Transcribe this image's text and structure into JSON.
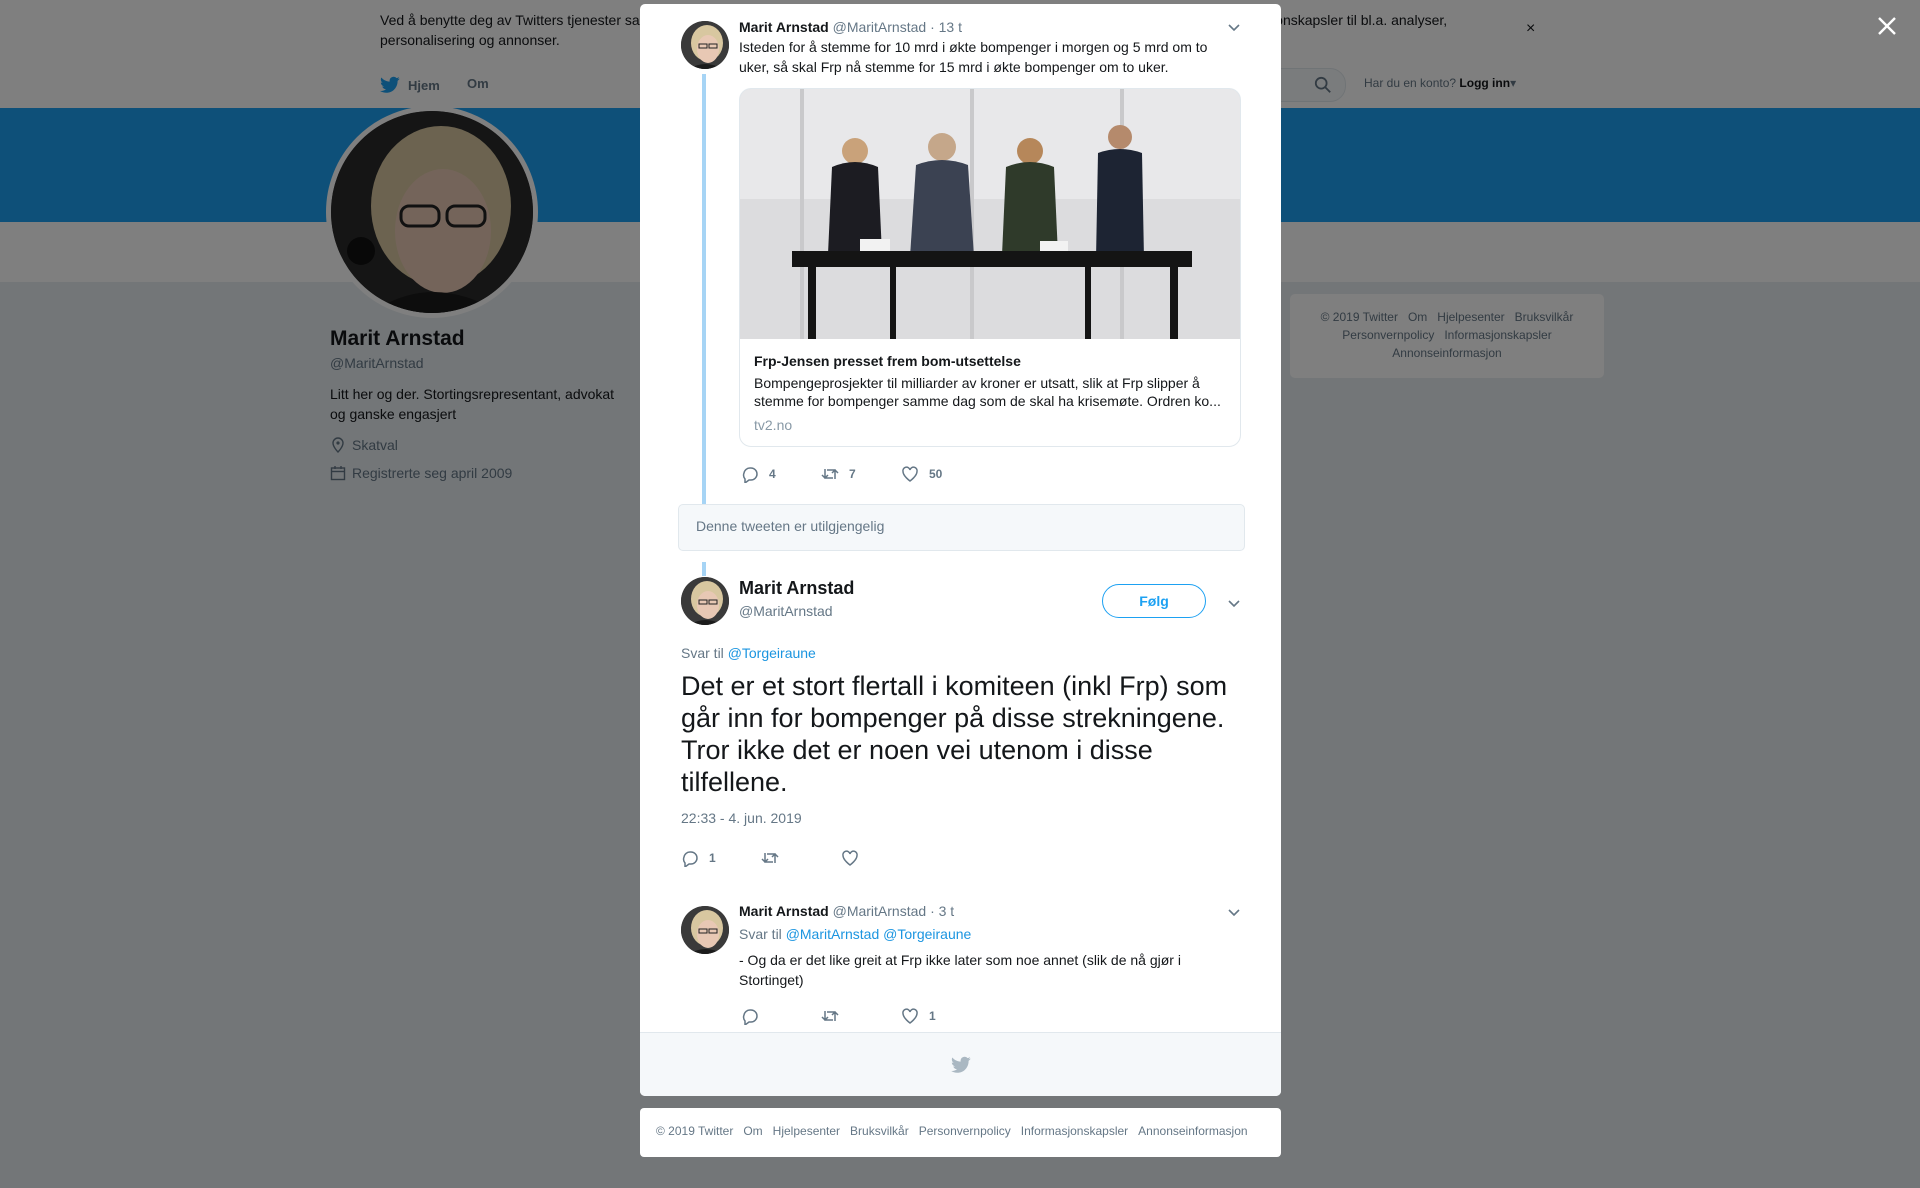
{
  "cookie_banner": {
    "text": "Ved å benytte deg av Twitters tjenester samtykker du til vår bruk av informasjonskapsler. Vi og våre partnere opererer globalt og bruker informasjonskapsler til bl.a. analyser, personalisering og annonser.",
    "close": "×"
  },
  "nav": {
    "home": "Hjem",
    "about": "Om",
    "login_prompt": "Har du en konto?",
    "login": "Logg inn"
  },
  "profile": {
    "name": "Marit Arnstad",
    "handle": "@MaritArnstad",
    "bio": "Litt her og der. Stortingsrepresentant, advokat og ganske engasjert",
    "location": "Skatval",
    "joined": "Registrerte seg april 2009"
  },
  "side_footer": {
    "links": [
      "© 2019 Twitter",
      "Om",
      "Hjelpesenter",
      "Bruksvilkår",
      "Personvernpolicy",
      "Informasjonskapsler",
      "Annonseinformasjon"
    ]
  },
  "thread": {
    "parent": {
      "name": "Marit Arnstad",
      "handle": "@MaritArnstad",
      "time": "· 13 t",
      "text": "Isteden for å stemme for 10 mrd i økte bompenger i morgen og 5 mrd om to uker, så skal Frp nå stemme for 15 mrd i økte bompenger om to uker.",
      "card": {
        "title": "Frp-Jensen presset frem bom-utsettelse",
        "description": "Bompengeprosjekter til milliarder av kroner er utsatt, slik at Frp slipper å stemme for bompenger samme dag som de skal ha krisemøte. Ordren ko...",
        "domain": "tv2.no"
      },
      "replies": "4",
      "retweets": "7",
      "likes": "50"
    },
    "unavailable": "Denne tweeten er utilgjengelig",
    "main": {
      "name": "Marit Arnstad",
      "handle": "@MaritArnstad",
      "follow": "Følg",
      "reply_prefix": "Svar til",
      "reply_to": "@Torgeiraune",
      "text": "Det er et stort flertall i komiteen (inkl Frp) som går inn for bompenger på disse strekningene. Tror ikke det er noen vei utenom i disse tilfellene.",
      "timestamp": "22:33 - 4. jun. 2019",
      "replies": "1",
      "retweets": "",
      "likes": ""
    },
    "reply": {
      "name": "Marit Arnstad",
      "handle": "@MaritArnstad",
      "time": "· 3 t",
      "reply_prefix": "Svar til",
      "reply_to_1": "@MaritArnstad",
      "reply_to_2": "@Torgeiraune",
      "text": "- Og da er det like greit at Frp ikke later som noe annet (slik de nå gjør i Stortinget)",
      "replies": "",
      "retweets": "",
      "likes": "1"
    }
  },
  "bottom_footer": {
    "links": [
      "© 2019 Twitter",
      "Om",
      "Hjelpesenter",
      "Bruksvilkår",
      "Personvernpolicy",
      "Informasjonskapsler",
      "Annonseinformasjon"
    ]
  },
  "colors": {
    "brand": "#1da1f2",
    "link": "#1b95e0",
    "thread_line": "#a6d4f5",
    "muted": "#657786"
  }
}
